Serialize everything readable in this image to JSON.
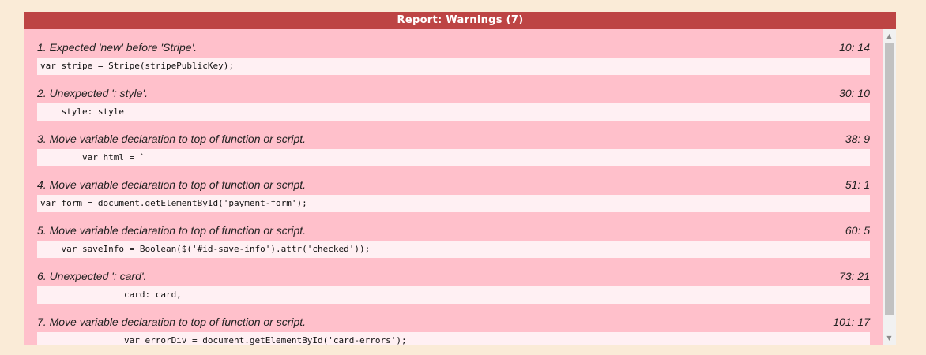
{
  "report": {
    "title": "Report: Warnings (7)",
    "warnings": [
      {
        "message": "1. Expected 'new' before 'Stripe'.",
        "location": "10: 14",
        "code": "var stripe = Stripe(stripePublicKey);"
      },
      {
        "message": "2. Unexpected ': style'.",
        "location": "30: 10",
        "code": "    style: style"
      },
      {
        "message": "3. Move variable declaration to top of function or script.",
        "location": "38: 9",
        "code": "        var html = `"
      },
      {
        "message": "4. Move variable declaration to top of function or script.",
        "location": "51: 1",
        "code": "var form = document.getElementById('payment-form');"
      },
      {
        "message": "5. Move variable declaration to top of function or script.",
        "location": "60: 5",
        "code": "    var saveInfo = Boolean($('#id-save-info').attr('checked'));"
      },
      {
        "message": "6. Unexpected ': card'.",
        "location": "73: 21",
        "code": "                card: card,"
      },
      {
        "message": "7. Move variable declaration to top of function or script.",
        "location": "101: 17",
        "code": "                var errorDiv = document.getElementById('card-errors');"
      }
    ]
  },
  "scrollbar": {
    "up_icon": "arrow-up-icon",
    "down_icon": "arrow-down-icon"
  },
  "colors": {
    "page_background": "#faebd7",
    "header_background": "#bd4444",
    "panel_background": "#ffc0cb",
    "code_background": "#fff0f3"
  }
}
